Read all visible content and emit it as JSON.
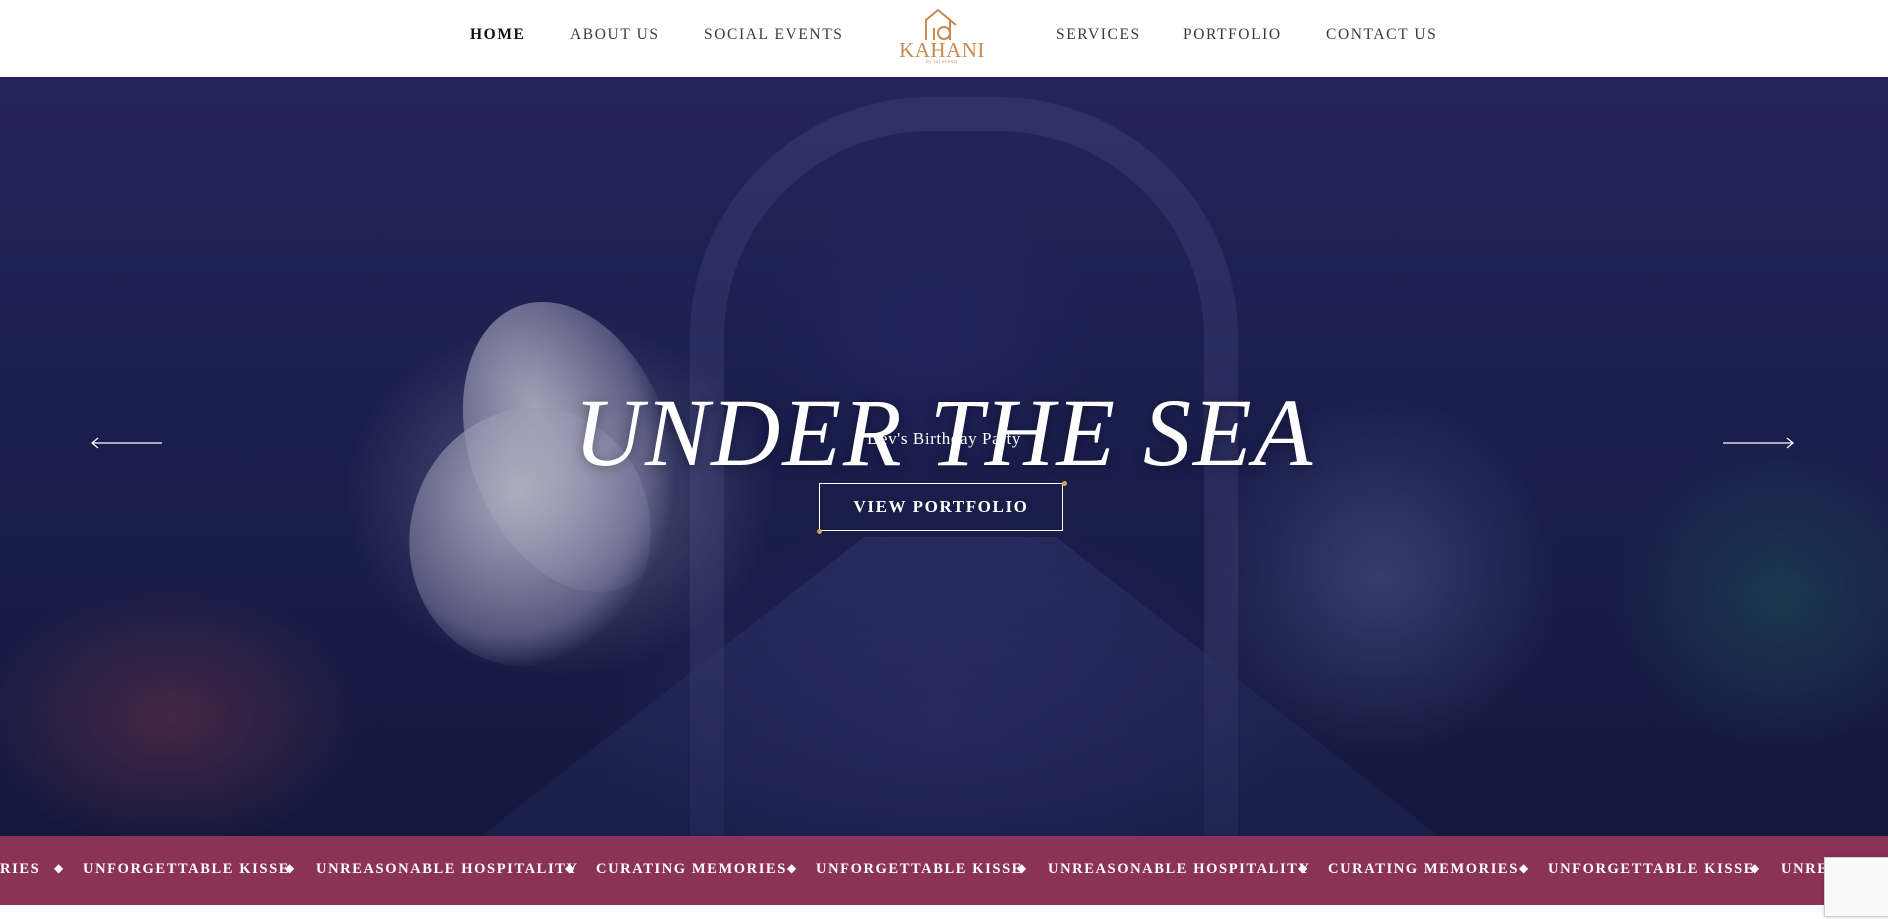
{
  "nav": {
    "items": [
      {
        "label": "HOME",
        "active": true
      },
      {
        "label": "ABOUT US"
      },
      {
        "label": "SOCIAL EVENTS"
      },
      {
        "label": "SERVICES"
      },
      {
        "label": "PORTFOLIO"
      },
      {
        "label": "CONTACT US"
      }
    ]
  },
  "logo": {
    "text": "KAHANI",
    "sub": "by lal events"
  },
  "hero": {
    "title": "UNDER THE SEA",
    "subtitle": "Dev's Birthday Party",
    "cta_label": "VIEW PORTFOLIO"
  },
  "marquee": {
    "items": [
      "RIES",
      "UNFORGETTABLE KISSE",
      "UNREASONABLE HOSPITALITY",
      "CURATING MEMORIES",
      "UNFORGETTABLE KISSE",
      "UNREASONABLE HOSPITALITY",
      "CURATING MEMORIES",
      "UNFORGETTABLE KISSE",
      "UNREASONAB"
    ],
    "separator": "◆"
  },
  "colors": {
    "accent": "#c98a4f",
    "marquee_bg": "#8b3356",
    "hero_base": "#1f2458"
  },
  "icons": {
    "prev": "arrow-left-icon",
    "next": "arrow-right-icon"
  }
}
